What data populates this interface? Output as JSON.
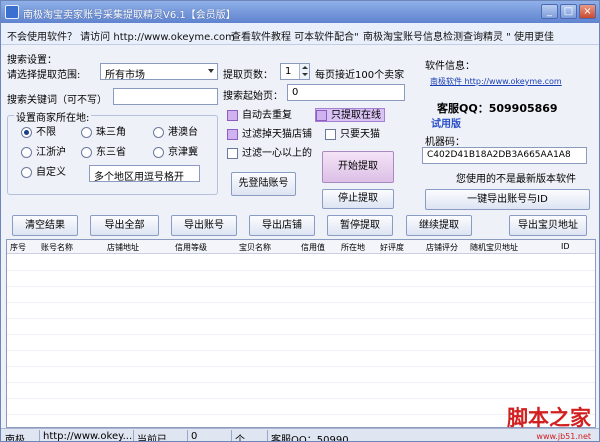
{
  "window": {
    "title": "南极淘宝卖家账号采集提取精灵V6.1【会员版】",
    "minimize_glyph": "_",
    "maximize_glyph": "□",
    "close_glyph": "×"
  },
  "adbar": {
    "text1": "不会使用软件？ 请访问 http://www.okeyme.com",
    "text2": "查看软件教程 可本软件配合\"",
    "text3": "南极淘宝账号信息检测查询精灵 \" 使用更佳"
  },
  "search": {
    "group_label": "搜索设置：",
    "range_label": "请选择提取范围:",
    "range_value": "所有市场",
    "keyword_label": "搜索关键词（可不写）",
    "keyword_value": "",
    "pages_label": "提取页数：",
    "pages_value": "1",
    "pages_hint": "每页接近100个卖家",
    "start_label": "搜索起始页：",
    "start_value": "0"
  },
  "location": {
    "title": "设置商家所在地:",
    "options": [
      "不限",
      "珠三角",
      "港澳台",
      "江浙沪",
      "东三省",
      "京津冀",
      "自定义"
    ],
    "selected": "不限",
    "custom_value": "多个地区用逗号格开"
  },
  "filters": {
    "dedupe": "自动去重复",
    "online_only": "只提取在线",
    "skip_mall": "过滤掉天猫店铺",
    "mall_only": "只要天猫",
    "filter_heart": "过滤一心以上的"
  },
  "buttons": {
    "login": "先登陆账号",
    "start": "开始提取",
    "stop": "停止提取",
    "export_account_id": "一键导出账号与ID",
    "clear": "清空结果",
    "export_all": "导出全部",
    "export_accounts": "导出账号",
    "export_shops": "导出店铺",
    "pause": "暂停提取",
    "resume": "继续提取",
    "export_item_urls": "导出宝贝地址"
  },
  "info": {
    "title": "软件信息：",
    "link": "南极软件 http://www.okeyme.com",
    "qq_label": "客服QQ：509905869",
    "trial": "试用版",
    "machine_label": "机器码：",
    "machine_code": "C402D41B18A2DB3A665AA1A8",
    "version_notice": "您使用的不是最新版本软件"
  },
  "table": {
    "columns": [
      "序号",
      "账号名称",
      "店铺地址",
      "信用等级",
      "宝贝名称",
      "信用值",
      "所在地",
      "好评度",
      "店铺评分",
      "随机宝贝地址",
      "ID"
    ]
  },
  "statusbar": {
    "cells": [
      "南极...",
      "http://www.okey...",
      "当前已...",
      "0",
      "个...",
      "客服QQ：50990..."
    ]
  },
  "watermark": {
    "big": "脚本之家",
    "small": "www.jb51.net"
  }
}
